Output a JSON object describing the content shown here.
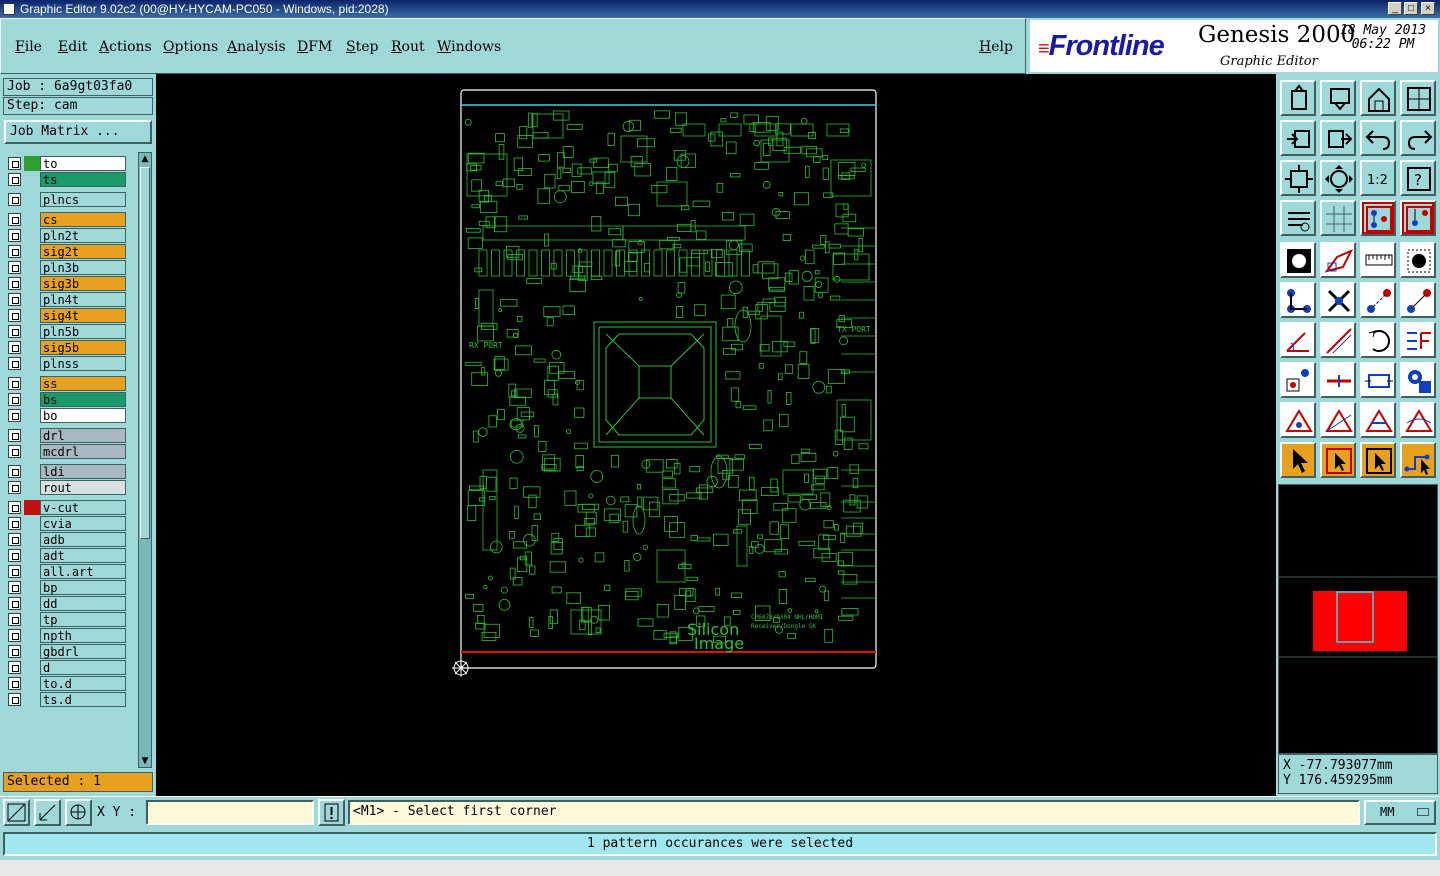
{
  "window": {
    "title": "Graphic Editor 9.02c2 (00@HY-HYCAM-PC050 - Windows, pid:2028)",
    "buttons": [
      "_",
      "□",
      "×"
    ]
  },
  "menu": [
    "File",
    "Edit",
    "Actions",
    "Options",
    "Analysis",
    "DFM",
    "Step",
    "Rout",
    "Windows"
  ],
  "help": "Help",
  "brand": {
    "logo": "Frontline",
    "product": "Genesis 2000",
    "subtitle": "Graphic Editor",
    "date": "18 May 2013",
    "time": "06:22 PM"
  },
  "job": {
    "job_label": "Job : 6a9gt03fa0",
    "step_label": "Step: cam",
    "matrix_button": "Job Matrix ..."
  },
  "layers": [
    {
      "name": "to",
      "color": "#ffffff",
      "indicator": "#30a030"
    },
    {
      "name": "ts",
      "color": "#1a9a6a",
      "indicator": ""
    },
    {
      "name": "plncs",
      "color": "#9fd8d8",
      "indicator": ""
    },
    {
      "name": "cs",
      "color": "#e8a020",
      "indicator": ""
    },
    {
      "name": "pln2t",
      "color": "#9fd8d8",
      "indicator": ""
    },
    {
      "name": "sig2t",
      "color": "#e8a020",
      "indicator": ""
    },
    {
      "name": "pln3b",
      "color": "#9fd8d8",
      "indicator": ""
    },
    {
      "name": "sig3b",
      "color": "#e8a020",
      "indicator": ""
    },
    {
      "name": "pln4t",
      "color": "#9fd8d8",
      "indicator": ""
    },
    {
      "name": "sig4t",
      "color": "#e8a020",
      "indicator": ""
    },
    {
      "name": "pln5b",
      "color": "#9fd8d8",
      "indicator": ""
    },
    {
      "name": "sig5b",
      "color": "#e8a020",
      "indicator": ""
    },
    {
      "name": "plnss",
      "color": "#9fd8d8",
      "indicator": ""
    },
    {
      "name": "ss",
      "color": "#e8a020",
      "indicator": ""
    },
    {
      "name": "bs",
      "color": "#1a9a6a",
      "indicator": ""
    },
    {
      "name": "bo",
      "color": "#ffffff",
      "indicator": ""
    },
    {
      "name": "drl",
      "color": "#a8b8c0",
      "indicator": ""
    },
    {
      "name": "mcdrl",
      "color": "#a8b8c0",
      "indicator": ""
    },
    {
      "name": "ldi",
      "color": "#a8b8c0",
      "indicator": ""
    },
    {
      "name": "rout",
      "color": "#d8e0e0",
      "indicator": ""
    },
    {
      "name": "v-cut",
      "color": "#9fd8d8",
      "indicator": "#c01010"
    },
    {
      "name": "cvia",
      "color": "#9fd8d8",
      "indicator": ""
    },
    {
      "name": "adb",
      "color": "#9fd8d8",
      "indicator": ""
    },
    {
      "name": "adt",
      "color": "#9fd8d8",
      "indicator": ""
    },
    {
      "name": "all.art",
      "color": "#9fd8d8",
      "indicator": ""
    },
    {
      "name": "bp",
      "color": "#9fd8d8",
      "indicator": ""
    },
    {
      "name": "dd",
      "color": "#9fd8d8",
      "indicator": ""
    },
    {
      "name": "tp",
      "color": "#9fd8d8",
      "indicator": ""
    },
    {
      "name": "npth",
      "color": "#9fd8d8",
      "indicator": ""
    },
    {
      "name": "gbdrl",
      "color": "#9fd8d8",
      "indicator": ""
    },
    {
      "name": "d",
      "color": "#9fd8d8",
      "indicator": ""
    },
    {
      "name": "to.d",
      "color": "#9fd8d8",
      "indicator": ""
    },
    {
      "name": "ts.d",
      "color": "#9fd8d8",
      "indicator": ""
    }
  ],
  "selected_label": "Selected : 1",
  "board": {
    "labels": {
      "rx_port": "RX PORT",
      "tx_port": "TX PORT",
      "brand_line1": "Silicon",
      "brand_line2": "Image",
      "part_no": "CP6078/9304 NHL/HDMI",
      "part_desc": "Receiver/Dongle SK"
    },
    "outline_color": "#ffffff",
    "trace_color": "#30c030",
    "top_edge_color": "#40d0e0",
    "bottom_edge_color": "#e01010"
  },
  "toolbar_icons": [
    "open-job-icon",
    "save-icon",
    "home-icon",
    "window-icon",
    "import-icon",
    "export-icon",
    "undo-icon",
    "redo-icon",
    "zoom-fit-icon",
    "zoom-home-icon",
    "zoom-1-2-icon",
    "help-icon",
    "tools-icon",
    "grid-icon",
    "snap-layers-icon",
    "snap-red-icon",
    "feature-icon",
    "polygon-icon",
    "ruler-icon",
    "pad-icon",
    "connect-icon",
    "cross-icon",
    "move-icon",
    "copy-icon",
    "angle-icon",
    "line-icon",
    "arc-icon",
    "mirror-icon",
    "pattern-icon",
    "stretch-icon",
    "resize-icon",
    "group-icon",
    "triangle-icon",
    "triangle-a-icon",
    "triangle-b-icon",
    "triangle-c-icon",
    "pointer-icon",
    "pointer-box-icon",
    "pointer-frame-icon",
    "pointer-net-icon"
  ],
  "coords": {
    "x": "X  -77.793077mm",
    "y": "Y  176.459295mm"
  },
  "cmd": {
    "xy_label": "X Y :",
    "xy_value": "",
    "prompt": "<M1> - Select first corner",
    "units": "MM"
  },
  "status": "1 pattern occurances were selected"
}
